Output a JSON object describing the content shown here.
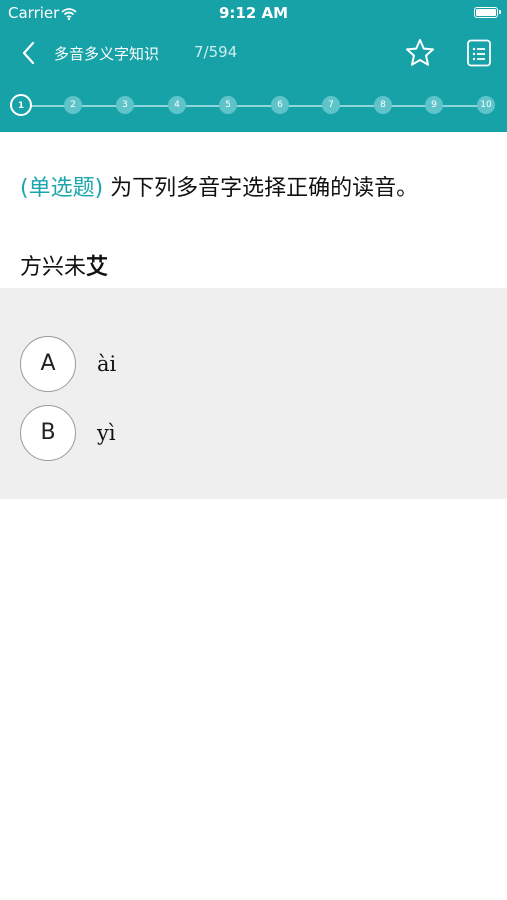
{
  "status_bar": {
    "carrier": "Carrier",
    "time": "9:12 AM"
  },
  "nav": {
    "title": "多音多义字知识",
    "current": "7",
    "separator": "/",
    "total": "594",
    "favorite_icon": "star-outline-icon",
    "answer_sheet_icon": "list-icon"
  },
  "progress": {
    "steps": [
      "1",
      "2",
      "3",
      "4",
      "5",
      "6",
      "7",
      "8",
      "9",
      "10"
    ],
    "current_step": "1"
  },
  "question": {
    "type_label": "(单选题)",
    "prompt": "为下列多音字选择正确的读音。",
    "stem_prefix": "方兴未",
    "stem_highlight": "艾"
  },
  "options": [
    {
      "letter": "A",
      "text": "ài"
    },
    {
      "letter": "B",
      "text": "yì"
    }
  ],
  "colors": {
    "accent": "#17a2a8",
    "options_bg": "#efefef"
  }
}
